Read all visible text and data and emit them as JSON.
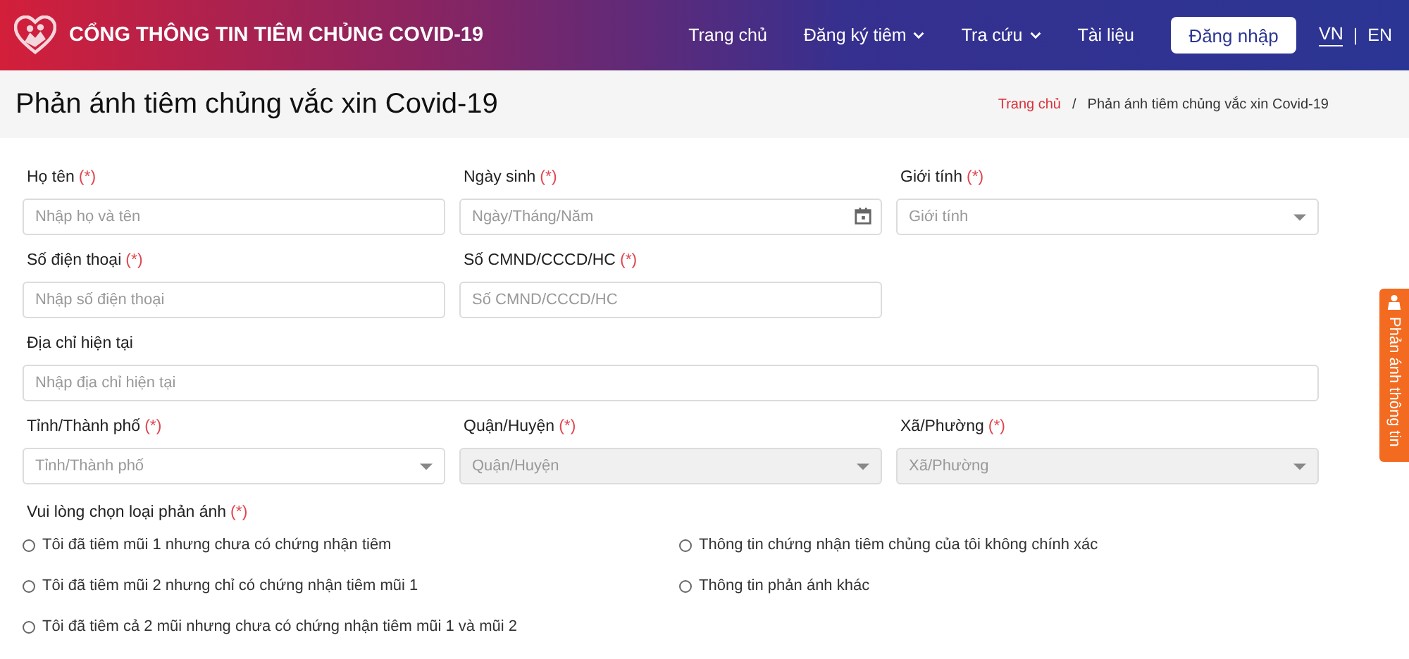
{
  "header": {
    "site_title": "CỔNG THÔNG TIN TIÊM CHỦNG COVID-19",
    "nav": [
      {
        "label": "Trang chủ",
        "dropdown": false
      },
      {
        "label": "Đăng ký tiêm",
        "dropdown": true
      },
      {
        "label": "Tra cứu",
        "dropdown": true
      },
      {
        "label": "Tài liệu",
        "dropdown": false
      }
    ],
    "login_button": "Đăng nhập",
    "languages": [
      {
        "label": "VN",
        "selected": true
      },
      {
        "label": "EN",
        "selected": false
      }
    ],
    "language_separator": "|"
  },
  "page_title": "Phản ánh tiêm chủng vắc xin Covid-19",
  "breadcrumb": [
    {
      "label": "Trang chủ",
      "kind": "link"
    },
    {
      "label": "Phản ánh tiêm chủng vắc xin Covid-19",
      "kind": "current"
    }
  ],
  "breadcrumb_separator": "/",
  "required_mark": "(*)",
  "fields": [
    {
      "label": "Họ tên",
      "required": true,
      "kind": "text",
      "placeholder": "Nhập họ và tên",
      "disabled": false,
      "full_width": false
    },
    {
      "label": "Ngày sinh",
      "required": true,
      "kind": "date",
      "placeholder": "Ngày/Tháng/Năm",
      "disabled": false,
      "full_width": false
    },
    {
      "label": "Giới tính",
      "required": true,
      "kind": "select",
      "placeholder": "Giới tính",
      "disabled": false,
      "full_width": false
    },
    {
      "label": "Số điện thoại",
      "required": true,
      "kind": "text",
      "placeholder": "Nhập số điện thoại",
      "disabled": false,
      "full_width": false
    },
    {
      "label": "Số CMND/CCCD/HC",
      "required": true,
      "kind": "text",
      "placeholder": "Số CMND/CCCD/HC",
      "disabled": false,
      "full_width": false
    },
    {
      "label": "Địa chỉ hiện tại",
      "required": false,
      "kind": "text",
      "placeholder": "Nhập địa chỉ hiện tại",
      "disabled": false,
      "full_width": true
    },
    {
      "label": "Tỉnh/Thành phố",
      "required": true,
      "kind": "select",
      "placeholder": "Tỉnh/Thành phố",
      "disabled": false,
      "full_width": false
    },
    {
      "label": "Quận/Huyện",
      "required": true,
      "kind": "select",
      "placeholder": "Quận/Huyện",
      "disabled": true,
      "full_width": false
    },
    {
      "label": "Xã/Phường",
      "required": true,
      "kind": "select",
      "placeholder": "Xã/Phường",
      "disabled": true,
      "full_width": false
    }
  ],
  "report_type": {
    "label": "Vui lòng chọn loại phản ánh",
    "required": true,
    "options": [
      {
        "label": "Tôi đã tiêm mũi 1 nhưng chưa có chứng nhận tiêm",
        "selected": false
      },
      {
        "label": "Thông tin chứng nhận tiêm chủng của tôi không chính xác",
        "selected": false
      },
      {
        "label": "Tôi đã tiêm mũi 2 nhưng chỉ có chứng nhận tiêm mũi 1",
        "selected": false
      },
      {
        "label": "Thông tin phản ánh khác",
        "selected": false
      },
      {
        "label": "Tôi đã tiêm cả 2 mũi nhưng chưa có chứng nhận tiêm mũi 1 và mũi 2",
        "selected": false
      }
    ]
  },
  "side_tab": "Phản ánh thông tin"
}
